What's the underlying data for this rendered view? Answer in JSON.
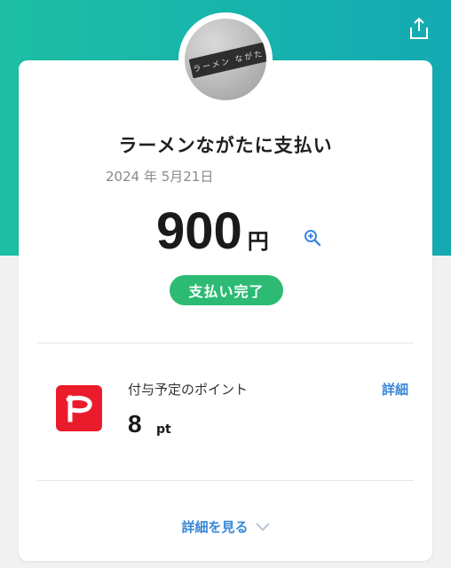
{
  "header": {
    "share_icon": "share-upload-icon"
  },
  "merchant": {
    "avatar_sign_text": "ラーメン ながた",
    "title": "ラーメンながたに支払い"
  },
  "payment": {
    "date": "2024 年 5月21日",
    "amount": "900",
    "currency": "円",
    "zoom_icon": "zoom-in-icon",
    "status": "支払い完了"
  },
  "points": {
    "logo_icon": "paypay-logo-icon",
    "label": "付与予定のポイント",
    "detail_link": "詳細",
    "value": "8",
    "unit": "pt"
  },
  "footer": {
    "see_details": "詳細を見る",
    "chevron_icon": "chevron-down-icon"
  },
  "colors": {
    "accent_teal": "#16b3ad",
    "status_green": "#2dbb74",
    "link_blue": "#3a87d8",
    "paypay_red": "#ea1c2c"
  }
}
